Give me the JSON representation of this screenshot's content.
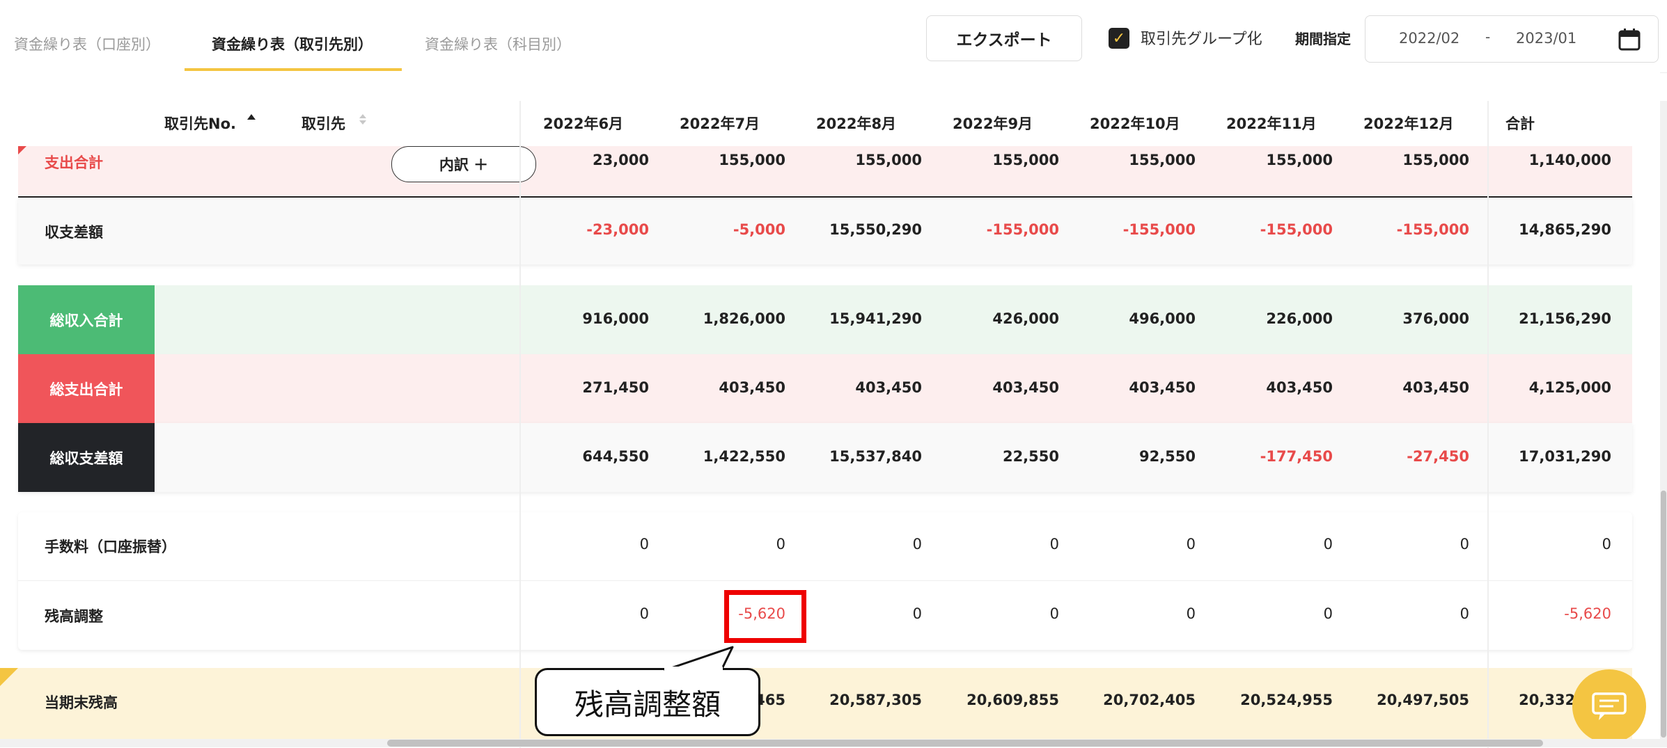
{
  "tabs": [
    {
      "label": "資金繰り表（口座別）"
    },
    {
      "label": "資金繰り表（取引先別）"
    },
    {
      "label": "資金繰り表（科目別）"
    }
  ],
  "toolbar": {
    "export_label": "エクスポート",
    "group_label": "取引先グループ化",
    "group_checked": true,
    "period_label": "期間指定",
    "date_from": "2022/02",
    "date_sep": "-",
    "date_to": "2023/01"
  },
  "header": {
    "col_partner_no": "取引先No.",
    "col_partner": "取引先",
    "months": [
      "2022年6月",
      "2022年7月",
      "2022年8月",
      "2022年9月",
      "2022年10月",
      "2022年11月",
      "2022年12月"
    ],
    "total": "合計"
  },
  "rows": {
    "expense_total": {
      "label": "支出合計",
      "breakdown": "内訳 ＋",
      "values": [
        "23,000",
        "155,000",
        "155,000",
        "155,000",
        "155,000",
        "155,000",
        "155,000"
      ],
      "total": "1,140,000"
    },
    "balance_diff": {
      "label": "収支差額",
      "values": [
        "-23,000",
        "-5,000",
        "15,550,290",
        "-155,000",
        "-155,000",
        "-155,000",
        "-155,000"
      ],
      "total": "14,865,290"
    },
    "gross_income": {
      "label": "総収入合計",
      "values": [
        "916,000",
        "1,826,000",
        "15,941,290",
        "426,000",
        "496,000",
        "226,000",
        "376,000"
      ],
      "total": "21,156,290"
    },
    "gross_expense": {
      "label": "総支出合計",
      "values": [
        "271,450",
        "403,450",
        "403,450",
        "403,450",
        "403,450",
        "403,450",
        "403,450"
      ],
      "total": "4,125,000"
    },
    "gross_diff": {
      "label": "総収支差額",
      "values": [
        "644,550",
        "1,422,550",
        "15,537,840",
        "22,550",
        "92,550",
        "-177,450",
        "-27,450"
      ],
      "total": "17,031,290"
    },
    "fee": {
      "label": "手数料（口座振替）",
      "values": [
        "0",
        "0",
        "0",
        "0",
        "0",
        "0",
        "0"
      ],
      "total": "0"
    },
    "adjustment": {
      "label": "残高調整",
      "values": [
        "0",
        "-5,620",
        "0",
        "0",
        "0",
        "0",
        "0"
      ],
      "total": "-5,620"
    },
    "ending_balance": {
      "label": "当期末残高",
      "values": [
        "",
        "465",
        "20,587,305",
        "20,609,855",
        "20,702,405",
        "20,524,955",
        "20,497,505"
      ],
      "total": "20,332,055"
    }
  },
  "annotation": {
    "callout_text": "残高調整額"
  },
  "colors": {
    "accent": "#f4c542",
    "negative": "#e84a4a",
    "income_green": "#4cbb75",
    "expense_red": "#f0555a",
    "dark": "#222428",
    "expense_bg": "#fdeeee",
    "income_bg": "#edf7ef",
    "ending_bg": "#fdf3d8"
  }
}
